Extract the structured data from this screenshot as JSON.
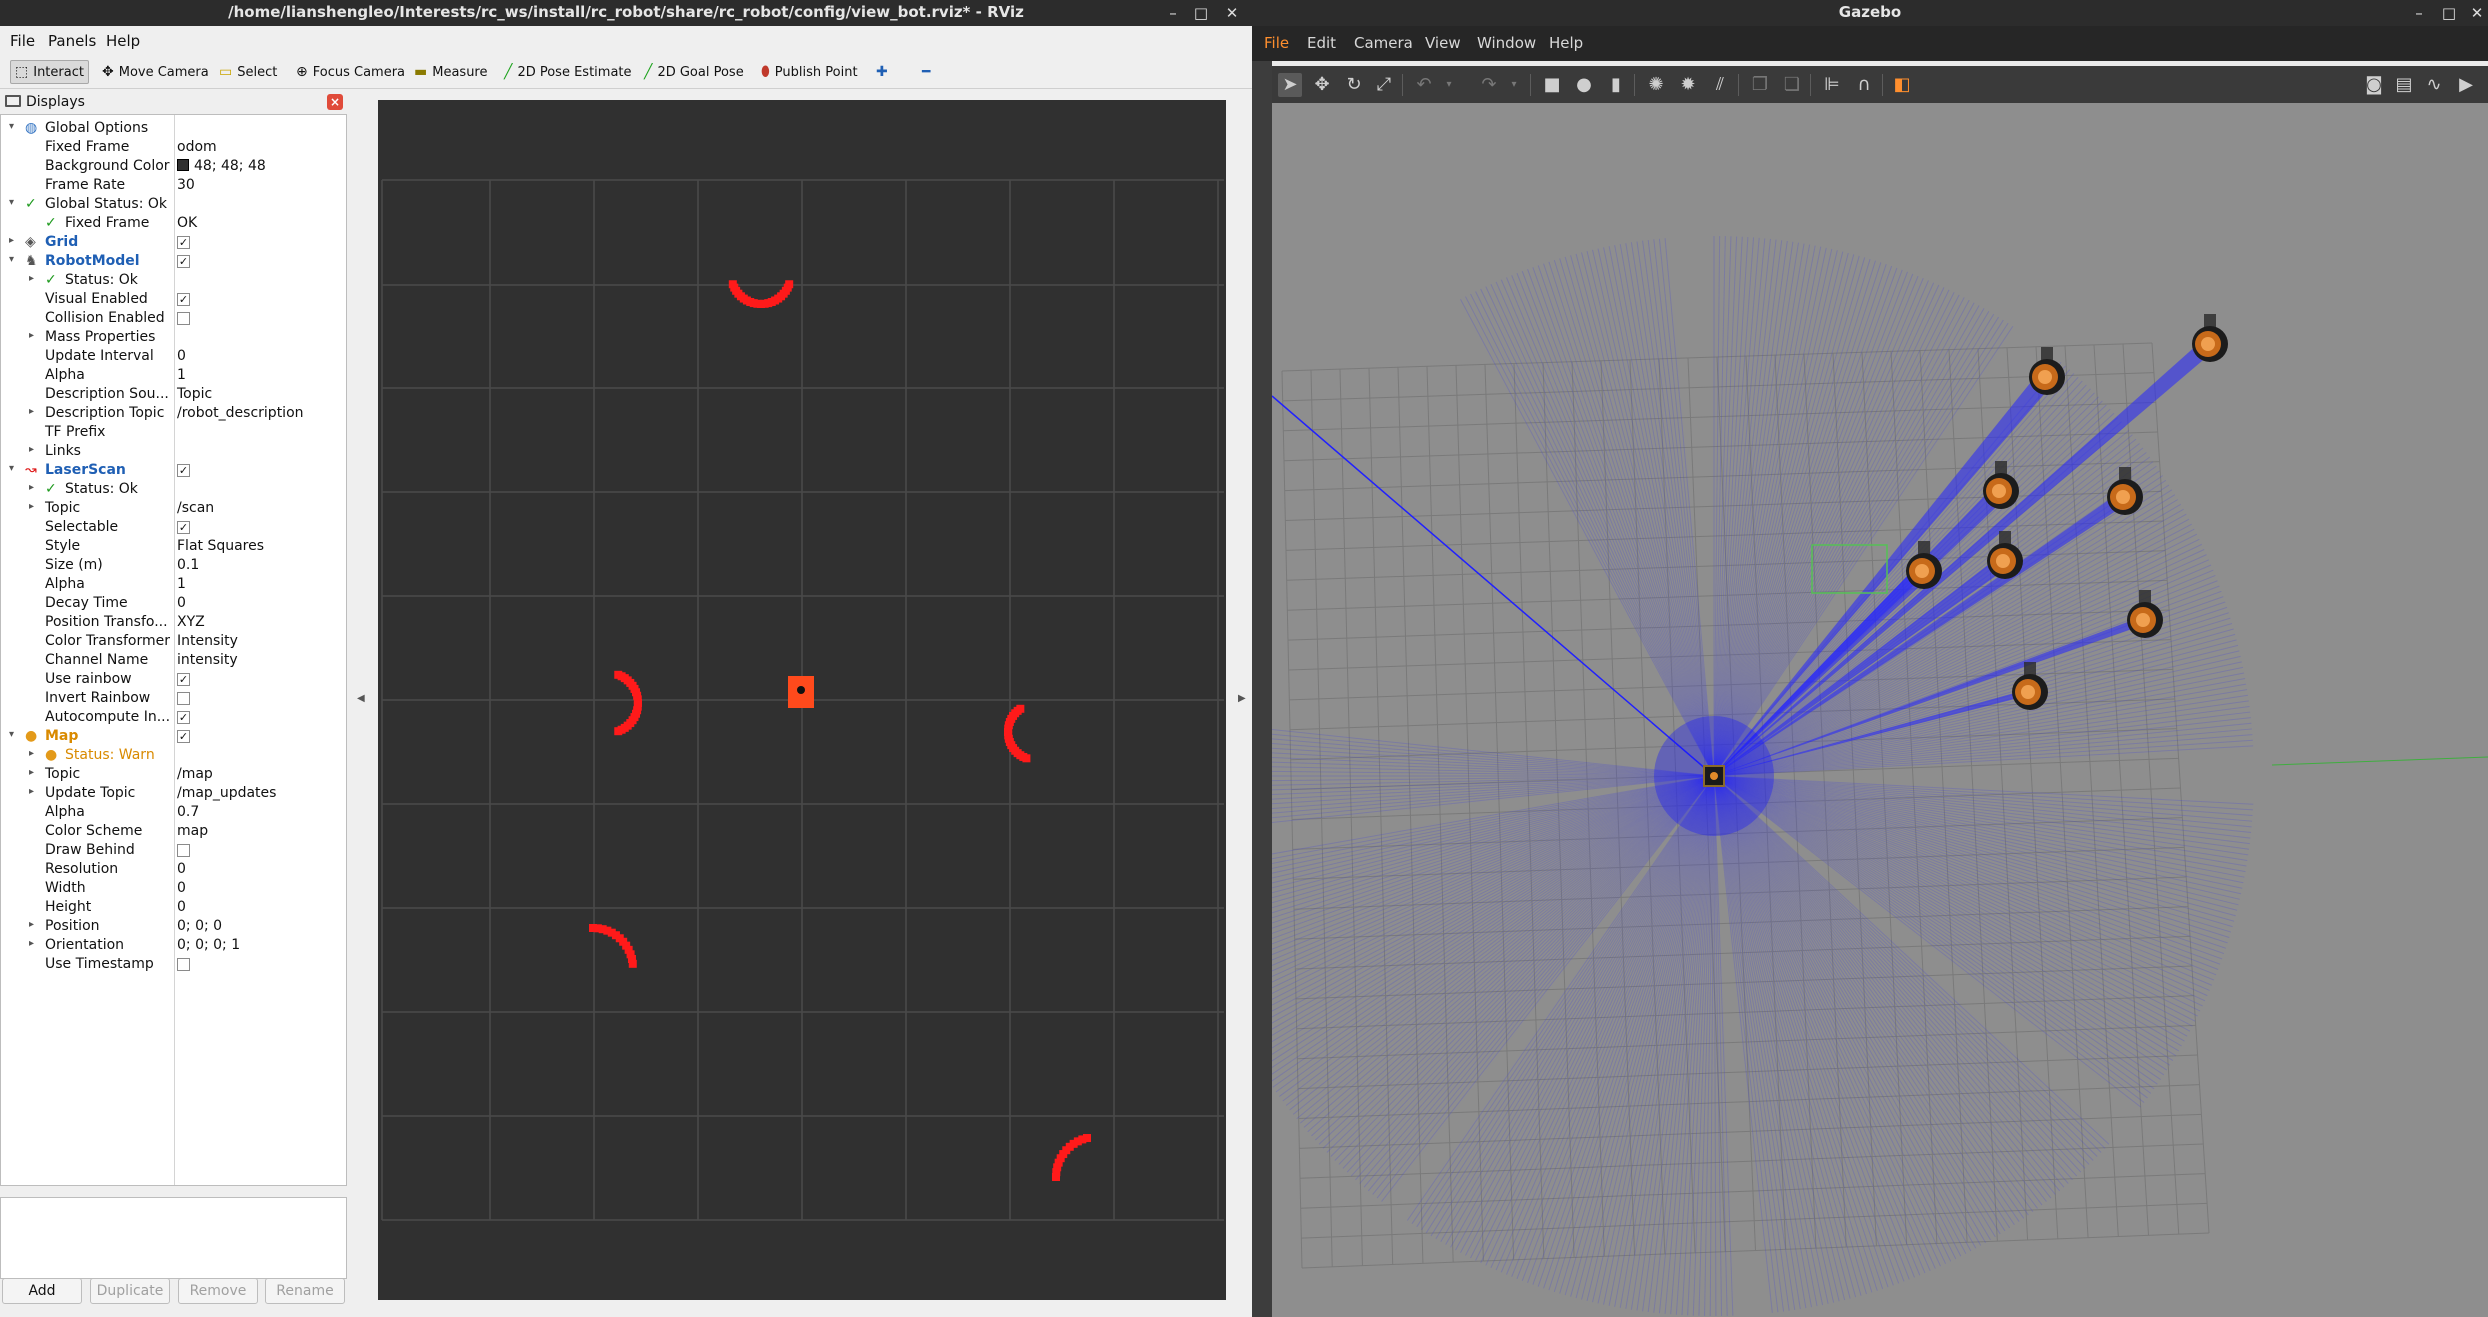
{
  "rviz": {
    "title": "/home/lianshengleo/Interests/rc_ws/install/rc_robot/share/rc_robot/config/view_bot.rviz* - RViz",
    "menu": [
      "File",
      "Panels",
      "Help"
    ],
    "tools": [
      {
        "label": "Interact",
        "icon": "cursor-icon"
      },
      {
        "label": "Move Camera",
        "icon": "move-camera-icon"
      },
      {
        "label": "Select",
        "icon": "select-icon"
      },
      {
        "label": "Focus Camera",
        "icon": "focus-camera-icon"
      },
      {
        "label": "Measure",
        "icon": "ruler-icon"
      },
      {
        "label": "2D Pose Estimate",
        "icon": "pose-estimate-icon"
      },
      {
        "label": "2D Goal Pose",
        "icon": "goal-pose-icon"
      },
      {
        "label": "Publish Point",
        "icon": "map-pin-icon"
      }
    ],
    "add_tool_icon": "plus-icon",
    "remove_tool_icon": "minus-icon",
    "displays_title": "Displays",
    "tree": [
      {
        "depth": 0,
        "expand": "open",
        "icon": "globe-icon",
        "name": "Global Options",
        "value": ""
      },
      {
        "depth": 1,
        "name": "Fixed Frame",
        "value": "odom"
      },
      {
        "depth": 1,
        "name": "Background Color",
        "value": "48; 48; 48",
        "swatch": "#303030"
      },
      {
        "depth": 1,
        "name": "Frame Rate",
        "value": "30"
      },
      {
        "depth": 0,
        "expand": "open",
        "icon": "check-icon",
        "name": "Global Status: Ok",
        "value": ""
      },
      {
        "depth": 1,
        "icon": "check-icon",
        "name": "Fixed Frame",
        "value": "OK"
      },
      {
        "depth": 0,
        "expand": "closed",
        "icon": "grid-icon",
        "name": "Grid",
        "checked": true,
        "style": "blue"
      },
      {
        "depth": 0,
        "expand": "open",
        "icon": "robot-icon",
        "name": "RobotModel",
        "checked": true,
        "style": "blue"
      },
      {
        "depth": 1,
        "expand": "closed",
        "icon": "check-icon",
        "name": "Status: Ok",
        "value": ""
      },
      {
        "depth": 1,
        "name": "Visual Enabled",
        "checked": true
      },
      {
        "depth": 1,
        "name": "Collision Enabled",
        "checked": false
      },
      {
        "depth": 1,
        "expand": "closed",
        "name": "Mass Properties",
        "value": ""
      },
      {
        "depth": 1,
        "name": "Update Interval",
        "value": "0"
      },
      {
        "depth": 1,
        "name": "Alpha",
        "value": "1"
      },
      {
        "depth": 1,
        "name": "Description Sou...",
        "value": "Topic"
      },
      {
        "depth": 1,
        "expand": "closed",
        "name": "Description Topic",
        "value": "/robot_description"
      },
      {
        "depth": 1,
        "name": "TF Prefix",
        "value": ""
      },
      {
        "depth": 1,
        "expand": "closed",
        "name": "Links",
        "value": ""
      },
      {
        "depth": 0,
        "expand": "open",
        "icon": "laser-icon",
        "name": "LaserScan",
        "checked": true,
        "style": "blue"
      },
      {
        "depth": 1,
        "expand": "closed",
        "icon": "check-icon",
        "name": "Status: Ok",
        "value": ""
      },
      {
        "depth": 1,
        "expand": "closed",
        "name": "Topic",
        "value": "/scan"
      },
      {
        "depth": 1,
        "name": "Selectable",
        "checked": true
      },
      {
        "depth": 1,
        "name": "Style",
        "value": "Flat Squares"
      },
      {
        "depth": 1,
        "name": "Size (m)",
        "value": "0.1"
      },
      {
        "depth": 1,
        "name": "Alpha",
        "value": "1"
      },
      {
        "depth": 1,
        "name": "Decay Time",
        "value": "0"
      },
      {
        "depth": 1,
        "name": "Position Transfo...",
        "value": "XYZ"
      },
      {
        "depth": 1,
        "name": "Color Transformer",
        "value": "Intensity"
      },
      {
        "depth": 1,
        "name": "Channel Name",
        "value": "intensity"
      },
      {
        "depth": 1,
        "name": "Use rainbow",
        "checked": true
      },
      {
        "depth": 1,
        "name": "Invert Rainbow",
        "checked": false
      },
      {
        "depth": 1,
        "name": "Autocompute In...",
        "checked": true
      },
      {
        "depth": 0,
        "expand": "open",
        "icon": "warn-icon",
        "name": "Map",
        "checked": true,
        "style": "warn-head"
      },
      {
        "depth": 1,
        "expand": "closed",
        "icon": "warn-icon",
        "name": "Status: Warn",
        "value": "",
        "style": "warn"
      },
      {
        "depth": 1,
        "expand": "closed",
        "name": "Topic",
        "value": "/map"
      },
      {
        "depth": 1,
        "expand": "closed",
        "name": "Update Topic",
        "value": "/map_updates"
      },
      {
        "depth": 1,
        "name": "Alpha",
        "value": "0.7"
      },
      {
        "depth": 1,
        "name": "Color Scheme",
        "value": "map"
      },
      {
        "depth": 1,
        "name": "Draw Behind",
        "checked": false
      },
      {
        "depth": 1,
        "name": "Resolution",
        "value": "0"
      },
      {
        "depth": 1,
        "name": "Width",
        "value": "0"
      },
      {
        "depth": 1,
        "name": "Height",
        "value": "0"
      },
      {
        "depth": 1,
        "expand": "closed",
        "name": "Position",
        "value": "0; 0; 0"
      },
      {
        "depth": 1,
        "expand": "closed",
        "name": "Orientation",
        "value": "0; 0; 0; 1"
      },
      {
        "depth": 1,
        "name": "Use Timestamp",
        "checked": false
      }
    ],
    "buttons": {
      "add": "Add",
      "duplicate": "Duplicate",
      "remove": "Remove",
      "rename": "Rename"
    }
  },
  "gazebo": {
    "title": "Gazebo",
    "menu": [
      "File",
      "Edit",
      "Camera",
      "View",
      "Window",
      "Help"
    ],
    "toolbar_icons": [
      "select-arrow-icon",
      "translate-icon",
      "rotate-icon",
      "scale-icon",
      "undo-icon",
      "redo-icon",
      "box-icon",
      "sphere-icon",
      "cylinder-icon",
      "point-light-icon",
      "spot-light-icon",
      "directional-light-icon",
      "copy-icon",
      "paste-icon",
      "align-icon",
      "snap-icon",
      "view-angle-icon",
      "screenshot-icon",
      "log-icon",
      "plot-icon",
      "video-icon"
    ]
  },
  "colors": {
    "laser": "#ff1a1a",
    "robot": "#ff4a1c",
    "scan_ray": "#3a3ae8",
    "grid_line": "#4a4a4a"
  }
}
